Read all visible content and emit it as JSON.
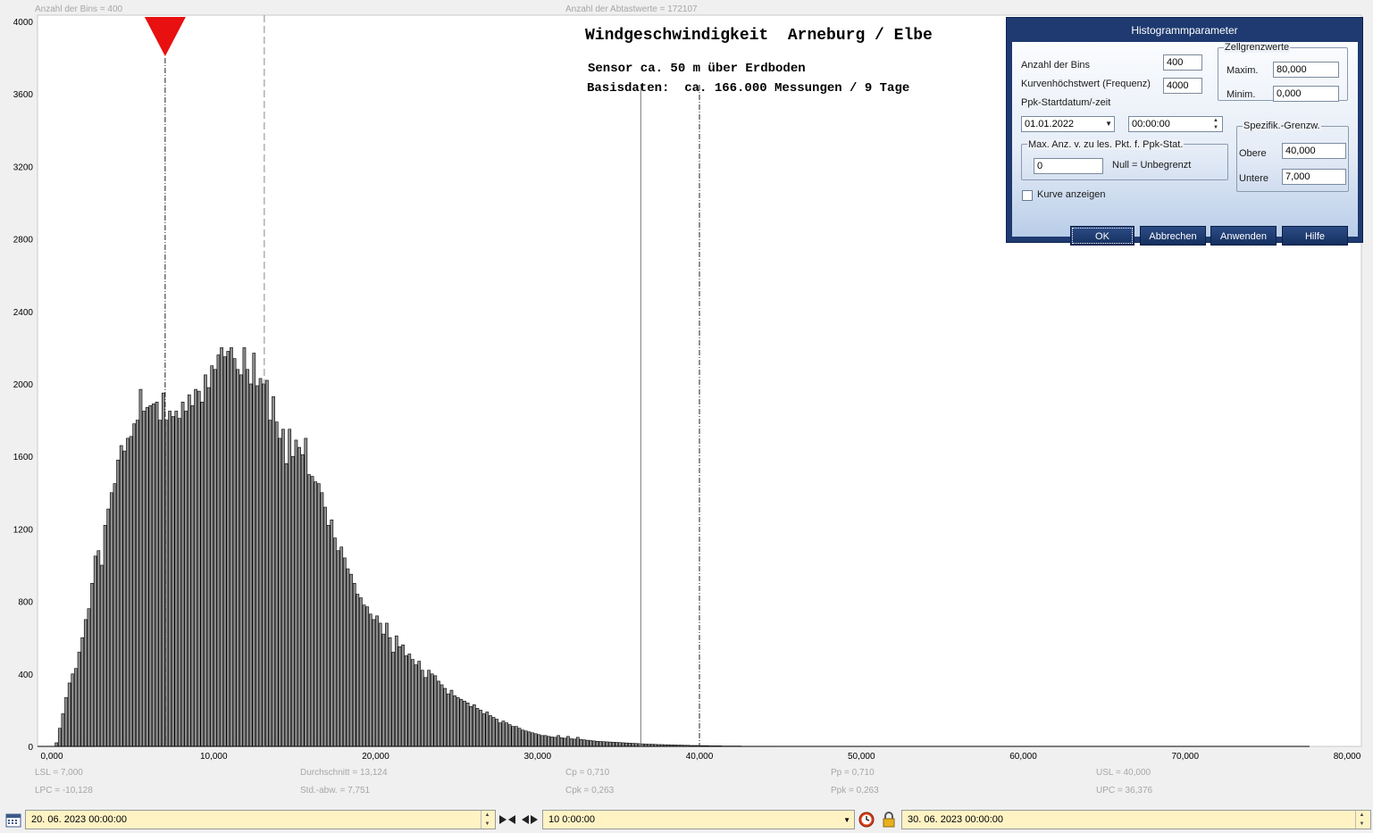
{
  "header": {
    "bins_label": "Anzahl der Bins =   400",
    "samples_label": "Anzahl der Abtastwerte = 172107"
  },
  "chart_data": {
    "type": "bar",
    "title": "Windgeschwindigkeit  Arneburg / Elbe",
    "subtitle_lines": [
      "Sensor ca. 50 m über Erdboden",
      "Basisdaten:  ca. 166.000 Messungen / 9 Tage"
    ],
    "xlim": [
      0,
      80
    ],
    "ylim": [
      0,
      4000
    ],
    "bin_width": 0.2,
    "x_tick_labels": [
      "0,000",
      "10,000",
      "20,000",
      "30,000",
      "40,000",
      "50,000",
      "60,000",
      "70,000",
      "80,000"
    ],
    "x_tick_values": [
      0,
      10,
      20,
      30,
      40,
      50,
      60,
      70,
      80
    ],
    "y_tick_labels": [
      "0",
      "400",
      "800",
      "1200",
      "1600",
      "2000",
      "2400",
      "2800",
      "3200",
      "3600",
      "4000"
    ],
    "y_tick_values": [
      0,
      400,
      800,
      1200,
      1600,
      2000,
      2400,
      2800,
      3200,
      3600,
      4000
    ],
    "bar_start": 0.2,
    "values": [
      20,
      100,
      180,
      270,
      350,
      400,
      430,
      520,
      600,
      700,
      760,
      900,
      1050,
      1080,
      1000,
      1220,
      1310,
      1400,
      1450,
      1580,
      1660,
      1630,
      1700,
      1710,
      1780,
      1800,
      1970,
      1850,
      1870,
      1880,
      1890,
      1900,
      1800,
      1950,
      1800,
      1850,
      1820,
      1850,
      1810,
      1900,
      1850,
      1940,
      1880,
      1970,
      1960,
      1900,
      2050,
      1980,
      2100,
      2080,
      2160,
      2200,
      2150,
      2180,
      2200,
      2140,
      2080,
      2050,
      2200,
      2080,
      2000,
      2170,
      1990,
      2030,
      2000,
      2020,
      1800,
      1930,
      1790,
      1700,
      1750,
      1560,
      1750,
      1600,
      1690,
      1650,
      1610,
      1700,
      1500,
      1490,
      1460,
      1450,
      1400,
      1320,
      1220,
      1250,
      1150,
      1080,
      1100,
      1040,
      980,
      950,
      900,
      840,
      820,
      780,
      770,
      730,
      700,
      720,
      680,
      620,
      680,
      600,
      520,
      610,
      550,
      560,
      500,
      510,
      480,
      450,
      470,
      420,
      380,
      420,
      400,
      390,
      360,
      340,
      320,
      290,
      310,
      280,
      270,
      260,
      250,
      240,
      220,
      230,
      210,
      200,
      180,
      190,
      170,
      160,
      150,
      130,
      140,
      130,
      120,
      110,
      110,
      100,
      90,
      85,
      80,
      75,
      70,
      65,
      60,
      60,
      55,
      52,
      50,
      60,
      48,
      45,
      55,
      42,
      40,
      50,
      38,
      36,
      34,
      32,
      30,
      28,
      27,
      26,
      25,
      24,
      23,
      22,
      21,
      20,
      19,
      18,
      17,
      16,
      15,
      14,
      13,
      12,
      12,
      11,
      10,
      10,
      9,
      9,
      8,
      8,
      7,
      7,
      6,
      6,
      5,
      5,
      5,
      4,
      4,
      4,
      3,
      3,
      3,
      3,
      2,
      2,
      2,
      2,
      2,
      2,
      1,
      1,
      1,
      1,
      1,
      1,
      1,
      1,
      1,
      1
    ],
    "markers": [
      {
        "name": "LSL",
        "value": 7.0,
        "style": "dash-dot"
      },
      {
        "name": "mean",
        "value": 13.124,
        "style": "dash"
      },
      {
        "name": "UPC",
        "value": 36.376,
        "style": "solid"
      },
      {
        "name": "USL",
        "value": 40.0,
        "style": "dash-dot"
      }
    ],
    "grid": false
  },
  "stats": {
    "lsl": "LSL = 7,000",
    "lpc": "LPC = -10,128",
    "mean": "Durchschnitt  = 13,124",
    "stddev": "Std.-abw.  = 7,751",
    "cp": "Cp  = 0,710",
    "cpk": "Cpk = 0,263",
    "pp": "Pp  = 0,710",
    "ppk": "Ppk = 0,263",
    "usl": "USL = 40,000",
    "upc": "UPC = 36,376"
  },
  "dialog": {
    "title": "Histogrammparameter",
    "bins_label": "Anzahl der Bins",
    "bins_value": "400",
    "freq_label": "Kurvenhöchstwert (Frequenz)",
    "freq_value": "4000",
    "ppk_label": "Ppk-Startdatum/-zeit",
    "ppk_date": "01.01.2022",
    "ppk_time": "00:00:00",
    "max_group_label": "Max. Anz. v. zu les. Pkt. f. Ppk-Stat.",
    "max_value": "0",
    "null_label": "Null = Unbegrenzt",
    "show_curve_label": "Kurve anzeigen",
    "cell_limits_title": "Zellgrenzwerte",
    "maxim_label": "Maxim.",
    "maxim_value": "80,000",
    "minim_label": "Minim.",
    "minim_value": "0,000",
    "spec_title": "Spezifik.-Grenzw.",
    "upper_label": "Obere",
    "upper_value": "40,000",
    "lower_label": "Untere",
    "lower_value": "7,000",
    "ok_label": "OK",
    "cancel_label": "Abbrechen",
    "apply_label": "Anwenden",
    "help_label": "Hilfe"
  },
  "bottom": {
    "start_datetime": "20. 06. 2023   00:00:00",
    "interval": "10  0:00:00",
    "end_datetime": "30. 06. 2023   00:00:00"
  },
  "colors": {
    "bar_fill": "#8c8c8c",
    "marker": "#e81010",
    "dialog_title_bg": "#1e3a70",
    "date_bg": "#fff3c4"
  }
}
